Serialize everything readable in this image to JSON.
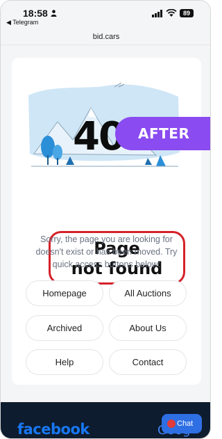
{
  "status_bar": {
    "time": "18:58",
    "back_app": "◀ Telegram",
    "battery": "89"
  },
  "url_bar": {
    "domain": "bid.cars"
  },
  "error": {
    "code": "404",
    "badge": "AFTER",
    "title_line1": "Page",
    "title_line2": "not found",
    "message": "Sorry, the page you are looking for doesn't exist or has been moved. Try quick access buttons below:"
  },
  "quick_buttons": {
    "homepage": "Homepage",
    "all_auctions": "All Auctions",
    "archived": "Archived",
    "about_us": "About Us",
    "help": "Help",
    "contact": "Contact"
  },
  "footer": {
    "facebook": "facebook",
    "google": "Goog"
  },
  "chat": {
    "label": "Chat"
  },
  "colors": {
    "accent_purple": "#8a4bf0",
    "highlight_red": "#d6212a",
    "footer_bg": "#0d1c2e",
    "facebook_blue": "#1877f2",
    "chat_blue": "#2f6fe4"
  }
}
